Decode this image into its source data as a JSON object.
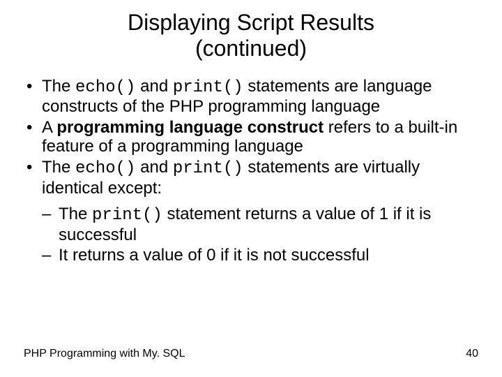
{
  "title1": "Displaying Script Results",
  "title2": "(continued)",
  "b1": {
    "a": "The ",
    "code1": "echo()",
    "b": " and ",
    "code2": "print()",
    "c": " statements are language constructs of the PHP programming language"
  },
  "b2": {
    "a": "A ",
    "bold": "programming language construct",
    "b": " refers to a built-in feature of a programming language"
  },
  "b3": {
    "a": "The ",
    "code1": "echo()",
    "b": " and ",
    "code2": "print()",
    "c": " statements are virtually identical except:"
  },
  "s1": {
    "a": "The ",
    "code": "print()",
    "b": " statement returns a value of 1 if it is successful"
  },
  "s2": "It returns a value of 0 if it is not successful",
  "footer_left": "PHP Programming with My. SQL",
  "footer_right": "40"
}
